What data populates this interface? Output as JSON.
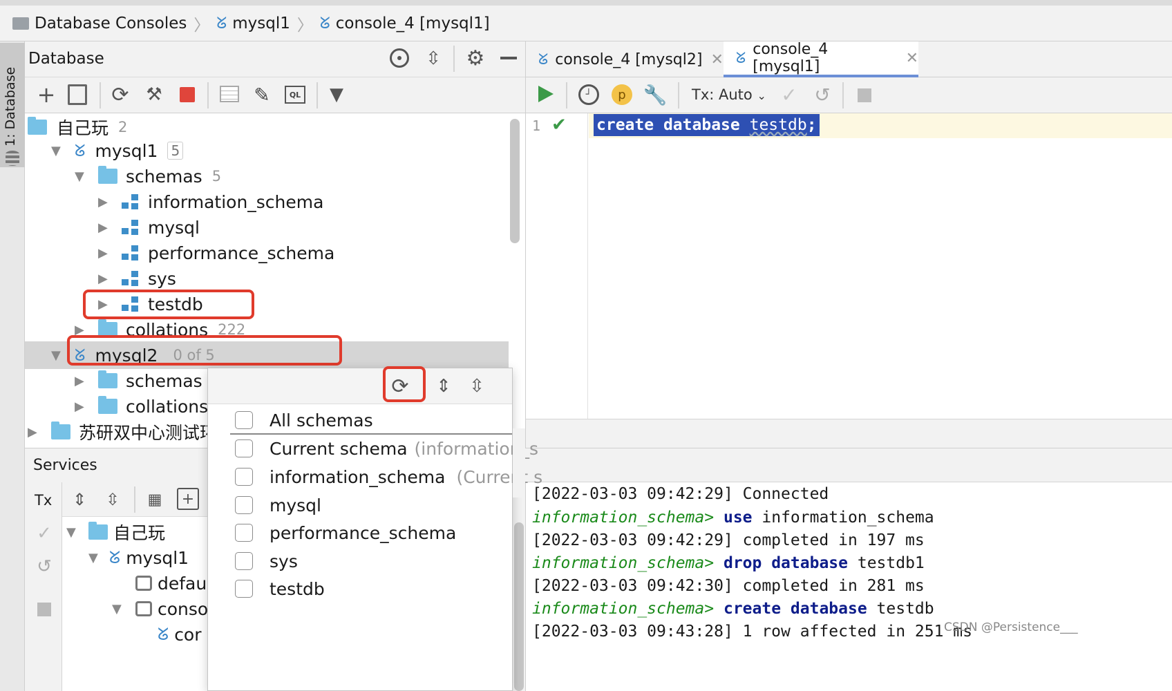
{
  "breadcrumb": {
    "item1": "Database Consoles",
    "item2": "mysql1",
    "item3": "console_4 [mysql1]"
  },
  "sidebar": {
    "label": "1: Database"
  },
  "db_panel": {
    "title": "Database"
  },
  "tree": {
    "group1": {
      "label": "自己玩",
      "count": "2"
    },
    "mysql1": {
      "label": "mysql1",
      "count": "5"
    },
    "schemas": {
      "label": "schemas",
      "count": "5"
    },
    "s1": "information_schema",
    "s2": "mysql",
    "s3": "performance_schema",
    "s4": "sys",
    "s5": "testdb",
    "collations": {
      "label": "collations",
      "count": "222"
    },
    "mysql2": {
      "label": "mysql2",
      "count": "0 of 5"
    },
    "schemas2": "schemas",
    "collations2": "collations",
    "group2": "苏研双中心测试环"
  },
  "popup": {
    "items": [
      "All schemas",
      "Current schema",
      "information_schema",
      "mysql",
      "performance_schema",
      "sys",
      "testdb"
    ],
    "current_hint": "(information_s",
    "info_hint": "(Current s"
  },
  "tabs": {
    "tab1": "console_4 [mysql2]",
    "tab2": "console_4 [mysql1]"
  },
  "editor_toolbar": {
    "tx": "Tx: Auto",
    "p": "p"
  },
  "editor": {
    "line_no": "1",
    "kw1": "create",
    "kw2": "database",
    "ident": "testdb",
    "semi": ";"
  },
  "services": {
    "title": "Services",
    "tx": "Tx",
    "group": "自己玩",
    "mysql1": "mysql1",
    "default": "defaul",
    "console": "conso",
    "co": "cor"
  },
  "log": {
    "l1": "[2022-03-03 09:42:29] Connected",
    "l2p": "information_schema>",
    "l2k": "use",
    "l2r": "information_schema",
    "l3": "[2022-03-03 09:42:29] completed in 197 ms",
    "l4p": "information_schema>",
    "l4k": "drop database",
    "l4r": "testdb1",
    "l5": "[2022-03-03 09:42:30] completed in 281 ms",
    "l6p": "information_schema>",
    "l6k": "create database",
    "l6r": "testdb",
    "l7": "[2022-03-03 09:43:28] 1 row affected in 251 ms"
  },
  "watermark": "CSDN @Persistence___",
  "colors": {
    "accent": "#2f66c7",
    "highlight": "#2e50b3",
    "red": "#e03b2c",
    "green": "#2f9e44"
  }
}
